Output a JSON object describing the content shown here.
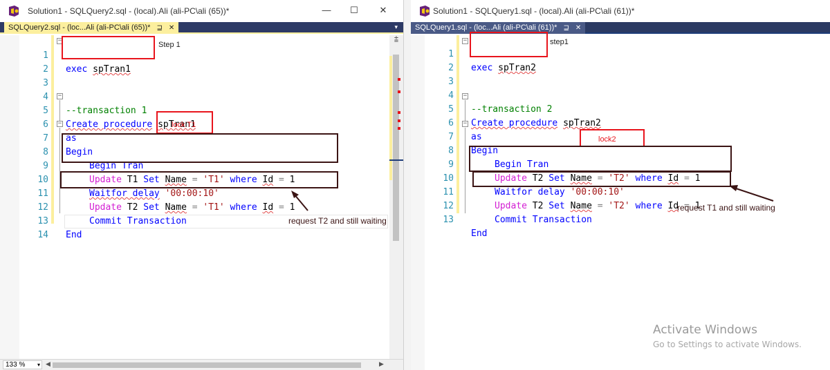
{
  "left_window": {
    "title": "Solution1 - SQLQuery2.sql - (local).Ali (ali-PC\\ali (65))*",
    "tab_label": "SQLQuery2.sql - (loc...Ali (ali-PC\\ali (65))*",
    "zoom": "133 %",
    "line_numbers": [
      "1",
      "2",
      "3",
      "4",
      "5",
      "6",
      "7",
      "8",
      "9",
      "10",
      "11",
      "12",
      "13",
      "14"
    ],
    "code": {
      "l1_kw": "exec",
      "l1_proc": "spTran1",
      "l4": "--transaction 1",
      "l5_kw": "Create procedure",
      "l5_proc": "spTran1",
      "l6": "as",
      "l7": "Begin",
      "l8": "Begin Tran",
      "l9_update": "Update",
      "l9_table": "T1",
      "l9_set": "Set",
      "l9_col": "Name",
      "l9_eq": "=",
      "l9_val": "'T1'",
      "l9_where": "where",
      "l9_id": "Id",
      "l9_eq2": "=",
      "l9_num": "1",
      "l10_kw": "Waitfor delay",
      "l10_val": "'00:00:10'",
      "l11_update": "Update",
      "l11_table": "T2",
      "l11_set": "Set",
      "l11_col": "Name",
      "l11_eq": "=",
      "l11_val": "'T1'",
      "l11_where": "where",
      "l11_id": "Id",
      "l11_eq2": "=",
      "l11_num": "1",
      "l12": "Commit Transaction",
      "l13": "End"
    },
    "annotations": {
      "step": "Step 1",
      "lock": "lock T1",
      "request": "request T2 and still waiting"
    }
  },
  "right_window": {
    "title": "Solution1 - SQLQuery1.sql - (local).Ali (ali-PC\\ali (61))*",
    "tab_label": "SQLQuery1.sql - (loc...Ali (ali-PC\\ali (61))*",
    "line_numbers": [
      "1",
      "2",
      "3",
      "4",
      "5",
      "6",
      "7",
      "8",
      "9",
      "10",
      "11",
      "12",
      "13"
    ],
    "code": {
      "l1_kw": "exec",
      "l1_proc": "spTran2",
      "l4": "--transaction 2",
      "l5_kw": "Create procedure",
      "l5_proc": "spTran2",
      "l6": "as",
      "l7": "Begin",
      "l8": "Begin Tran",
      "l9_update": "Update",
      "l9_table": "T2",
      "l9_set": "Set",
      "l9_col": "Name",
      "l9_eq": "=",
      "l9_val": "'T2'",
      "l9_where": "where",
      "l9_id": "Id",
      "l9_eq2": "=",
      "l9_num": "1",
      "l10_kw": "Waitfor delay",
      "l10_val": "'00:00:10'",
      "l11_update": "Update",
      "l11_table": "T2",
      "l11_set": "Set",
      "l11_col": "Name",
      "l11_eq": "=",
      "l11_val": "'T2'",
      "l11_where": "where",
      "l11_id": "Id",
      "l11_eq2": "=",
      "l11_num": "1",
      "l12": "Commit Transaction",
      "l13": "End"
    },
    "annotations": {
      "step": "step1",
      "lock": "lock2",
      "request": "request T1 and still waiting"
    }
  },
  "watermark": {
    "title": "Activate Windows",
    "subtitle": "Go to Settings to activate Windows."
  },
  "icons": {
    "minimize": "—",
    "maximize": "☐",
    "close": "✕",
    "pin": "⊒",
    "tab_close": "✕",
    "dropdown": "▾",
    "fold_minus": "−"
  },
  "colors": {
    "keyword": "#0000ff",
    "pink_keyword": "#d31ed3",
    "string": "#a31515",
    "comment": "#008000",
    "line_number": "#2b91af",
    "annotation_red": "#e8141c",
    "annotation_dark": "#3b1414",
    "tab_active": "#fcef9e",
    "tab_strip": "#2d3a66"
  }
}
